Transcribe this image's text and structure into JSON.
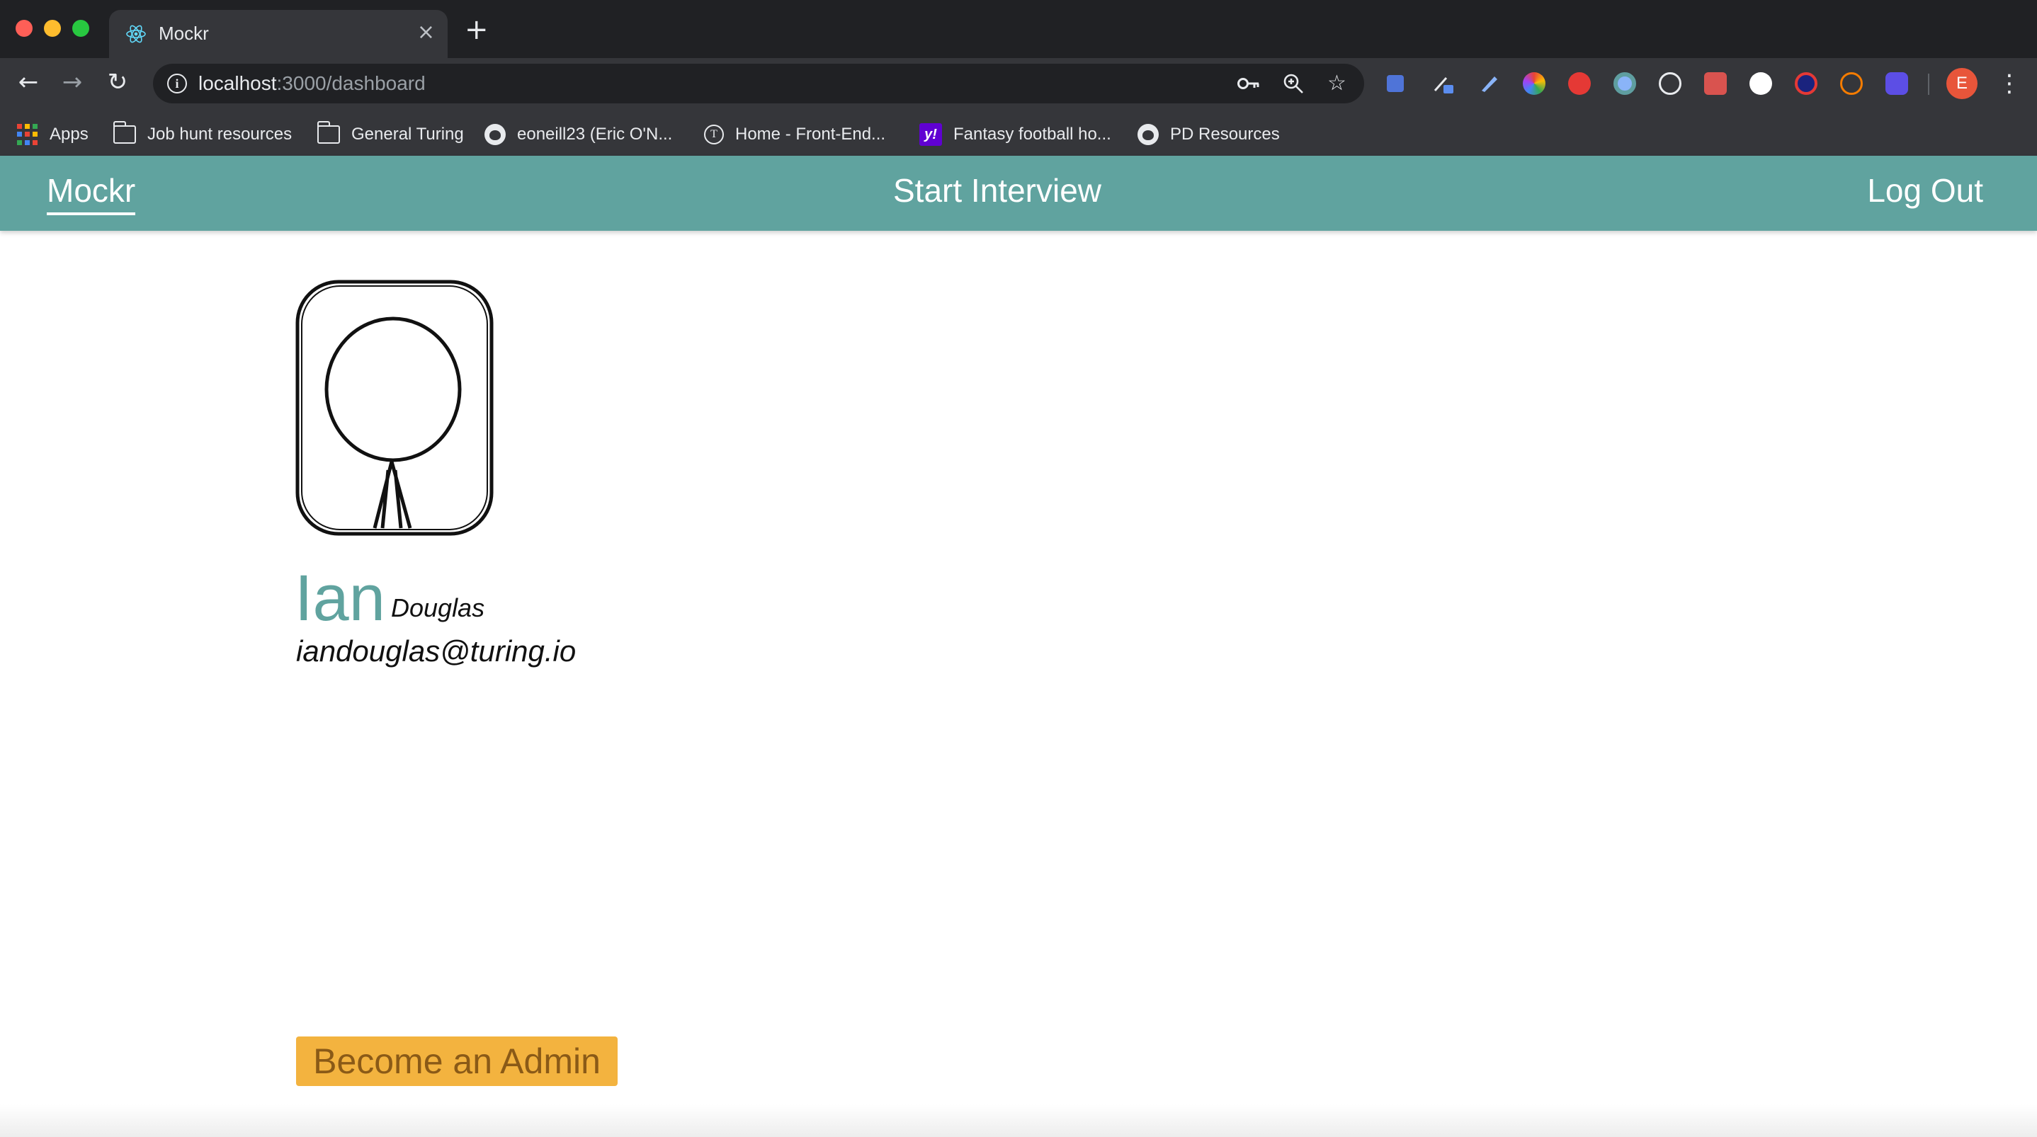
{
  "browser": {
    "tab": {
      "title": "Mockr",
      "favicon": "react-icon"
    },
    "url": {
      "host": "localhost",
      "path": ":3000/dashboard"
    },
    "bookmarks": [
      {
        "label": "Apps",
        "icon": "apps-grid-icon"
      },
      {
        "label": "Job hunt resources",
        "icon": "folder-icon"
      },
      {
        "label": "General Turing",
        "icon": "folder-icon"
      },
      {
        "label": "eoneill23 (Eric O'N...",
        "icon": "github-icon"
      },
      {
        "label": "Home - Front-End...",
        "icon": "turing-icon"
      },
      {
        "label": "Fantasy football ho...",
        "icon": "yahoo-icon"
      },
      {
        "label": "PD Resources",
        "icon": "github-icon"
      }
    ],
    "profile_initial": "E",
    "colors": {
      "chrome_dark": "#202124",
      "chrome": "#35363a",
      "profile": "#e8553a"
    }
  },
  "app": {
    "nav": {
      "brand": "Mockr",
      "start_interview": "Start Interview",
      "logout": "Log Out"
    },
    "user": {
      "first_name": "Ian",
      "last_name": "Douglas",
      "email": "iandouglas@turing.io",
      "avatar_icon": "stick-figure-avatar-icon"
    },
    "admin_button": "Become an Admin",
    "colors": {
      "nav": "#60a39f",
      "accent": "#60a39f",
      "admin_button": "#f3b33f"
    }
  }
}
